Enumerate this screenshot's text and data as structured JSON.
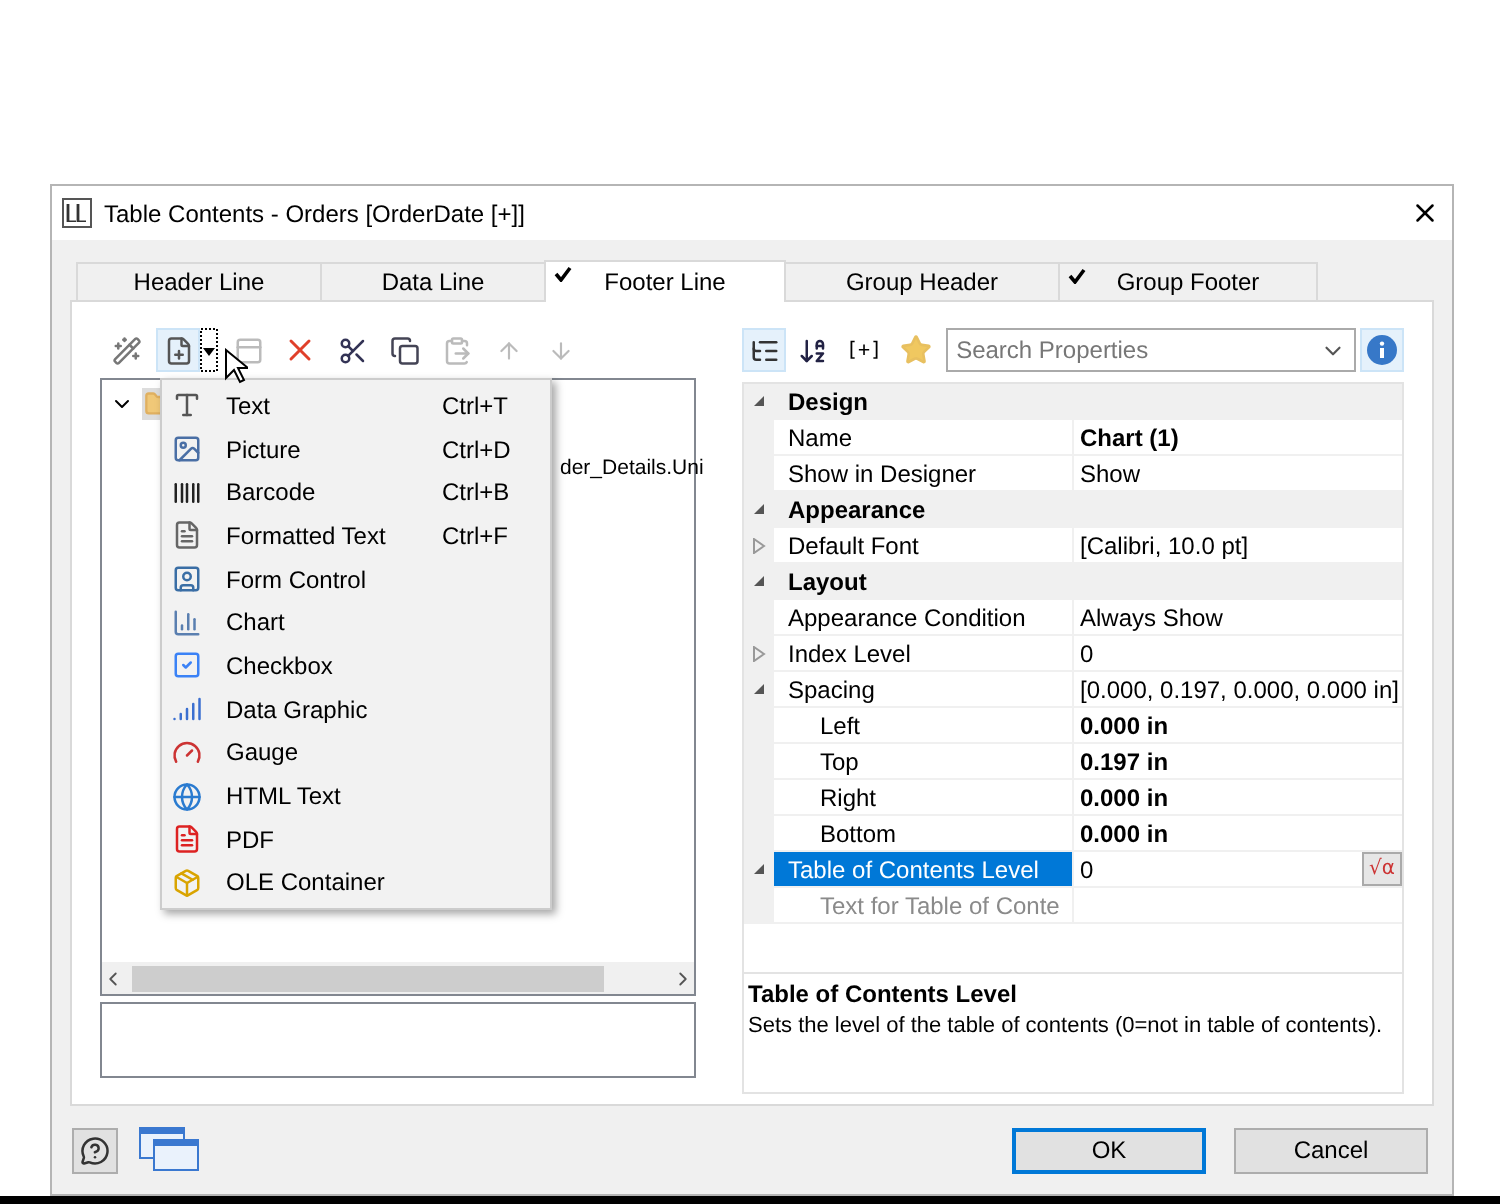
{
  "window": {
    "title": "Table Contents - Orders [OrderDate [+]]"
  },
  "tabs": [
    {
      "label": "Header Line",
      "checked": false,
      "selected": false
    },
    {
      "label": "Data Line",
      "checked": false,
      "selected": false
    },
    {
      "label": "Footer Line",
      "checked": true,
      "selected": true
    },
    {
      "label": "Group Header",
      "checked": false,
      "selected": false
    },
    {
      "label": "Group Footer",
      "checked": true,
      "selected": false
    }
  ],
  "tree": {
    "expanded": true,
    "child_label": "der_Details.Uni"
  },
  "insert_menu": [
    {
      "label": "Text",
      "shortcut": "Ctrl+T"
    },
    {
      "label": "Picture",
      "shortcut": "Ctrl+D"
    },
    {
      "label": "Barcode",
      "shortcut": "Ctrl+B"
    },
    {
      "label": "Formatted Text",
      "shortcut": "Ctrl+F"
    },
    {
      "label": "Form Control"
    },
    {
      "label": "Chart"
    },
    {
      "label": "Checkbox"
    },
    {
      "label": "Data Graphic"
    },
    {
      "label": "Gauge"
    },
    {
      "label": "HTML Text"
    },
    {
      "label": "PDF"
    },
    {
      "label": "OLE Container"
    }
  ],
  "properties_toolbar": {
    "categorized_selected": true,
    "expand_button": "[+]",
    "search_placeholder": "Search Properties",
    "info_selected": true
  },
  "properties": [
    {
      "kind": "category",
      "label": "Design",
      "expanded": true
    },
    {
      "kind": "property",
      "label": "Name",
      "value": "Chart (1)",
      "bold": true,
      "selected": false
    },
    {
      "kind": "property",
      "label": "Show in Designer",
      "value": "Show",
      "selected": false
    },
    {
      "kind": "category",
      "label": "Appearance",
      "expanded": true
    },
    {
      "kind": "property",
      "label": "Default Font",
      "value": "[Calibri, 10.0 pt]",
      "expanded": false,
      "selected": false
    },
    {
      "kind": "category",
      "label": "Layout",
      "expanded": true
    },
    {
      "kind": "property",
      "label": "Appearance Condition",
      "value": "Always Show",
      "selected": false
    },
    {
      "kind": "property",
      "label": "Index Level",
      "value": "0",
      "expanded": false,
      "selected": false
    },
    {
      "kind": "property",
      "label": "Spacing",
      "value": "[0.000, 0.197, 0.000, 0.000 in]",
      "expanded": true,
      "selected": false
    },
    {
      "kind": "sub",
      "label": "Left",
      "value": "0.000 in",
      "bold": true,
      "selected": false
    },
    {
      "kind": "sub",
      "label": "Top",
      "value": "0.197 in",
      "bold": true,
      "selected": false
    },
    {
      "kind": "sub",
      "label": "Right",
      "value": "0.000 in",
      "bold": true,
      "selected": false
    },
    {
      "kind": "sub",
      "label": "Bottom",
      "value": "0.000 in",
      "bold": true,
      "selected": false
    },
    {
      "kind": "property",
      "label": "Table of Contents Level",
      "value": "0",
      "expanded": true,
      "selected": true,
      "formula": "√α"
    },
    {
      "kind": "sub",
      "label": "Text for Table of Conte",
      "disabled": true,
      "selected": false
    }
  ],
  "description": {
    "title": "Table of Contents Level",
    "text": "Sets the level of the table of contents (0=not in table of contents)."
  },
  "buttons": [
    {
      "label": "OK",
      "default": true
    },
    {
      "label": "Cancel",
      "default": false
    }
  ]
}
